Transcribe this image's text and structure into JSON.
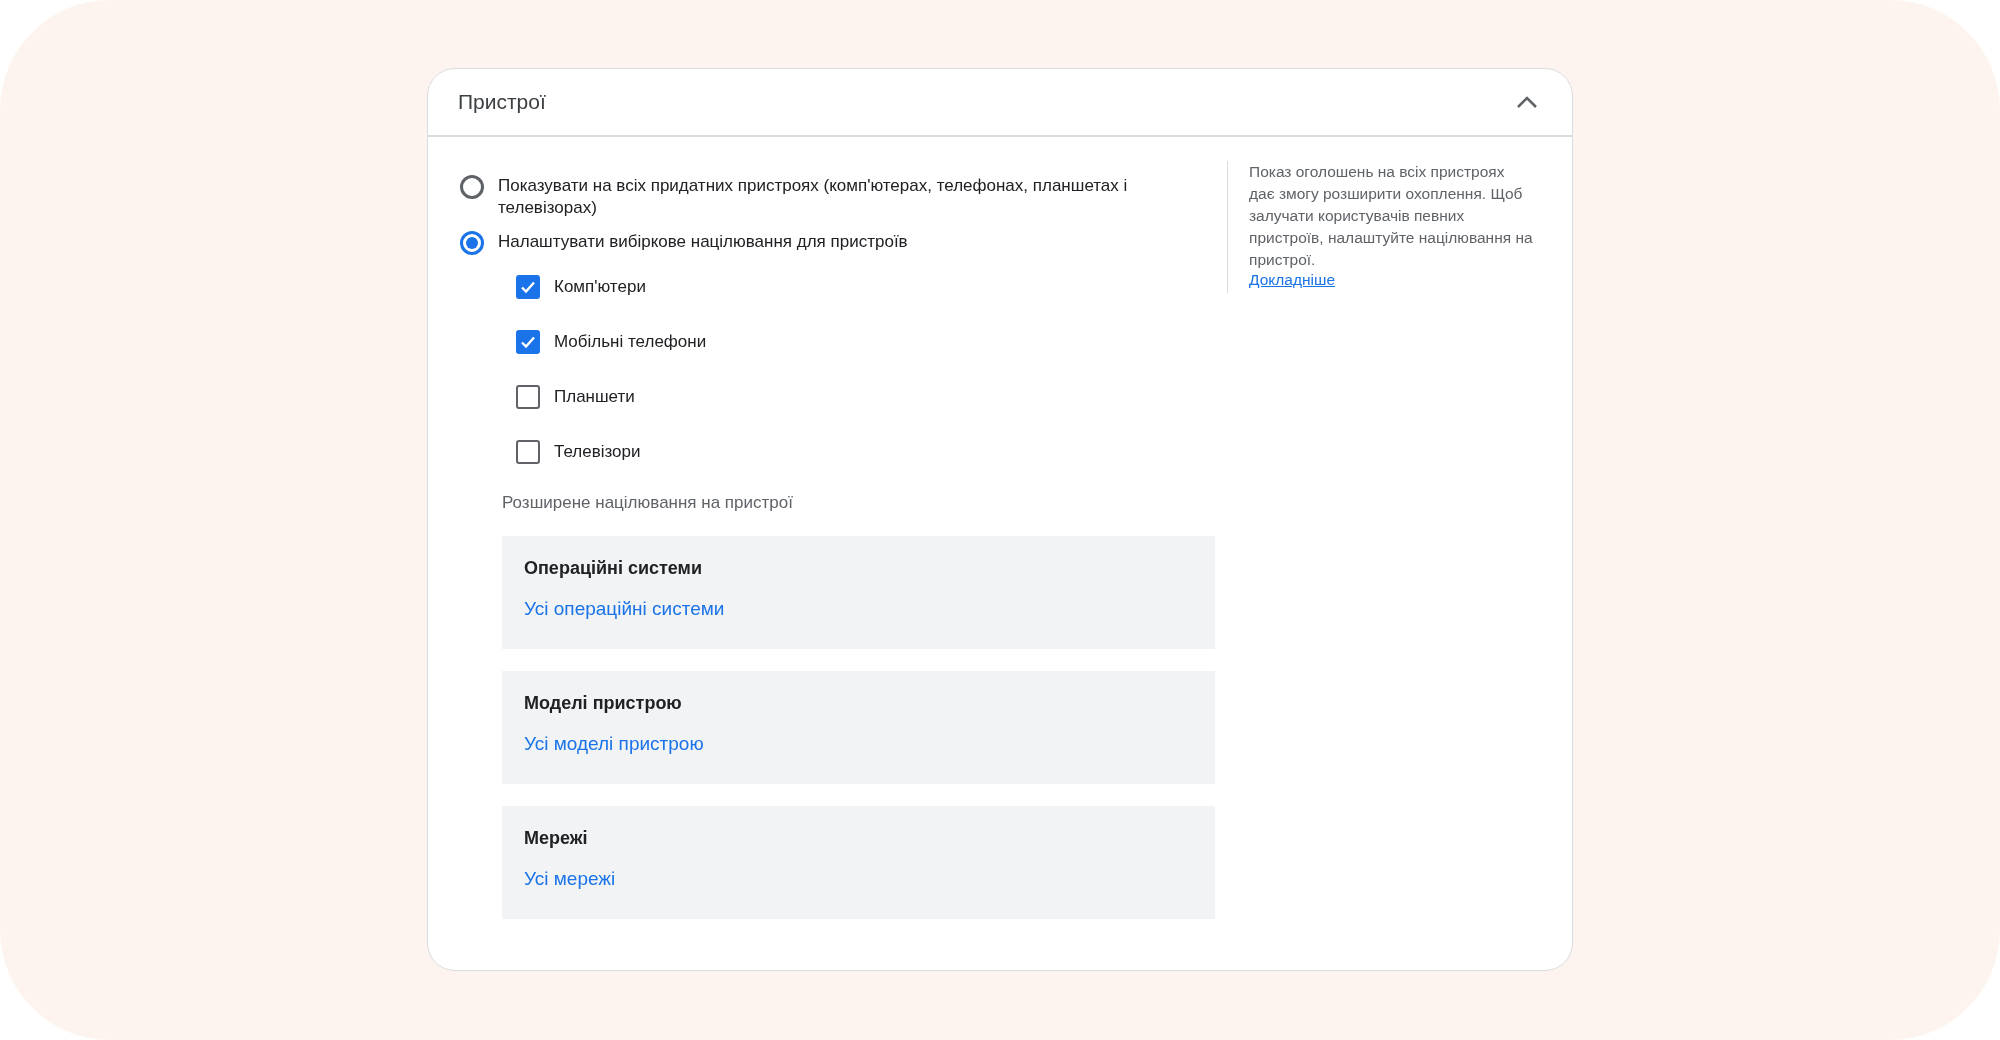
{
  "section": {
    "title": "Пристрої",
    "expanded": true
  },
  "options": [
    {
      "label": "Показувати на всіх придатних пристроях (комп'ютерах, телефонах, планшетах і телевізорах)",
      "selected": false
    },
    {
      "label": "Налаштувати вибіркове націлювання для пристроїв",
      "selected": true
    }
  ],
  "devices": [
    {
      "label": "Комп'ютери",
      "checked": true
    },
    {
      "label": "Мобільні телефони",
      "checked": true
    },
    {
      "label": "Планшети",
      "checked": false
    },
    {
      "label": "Телевізори",
      "checked": false
    }
  ],
  "advanced": {
    "heading": "Розширене націлювання на пристрої",
    "panels": [
      {
        "title": "Операційні системи",
        "link": "Усі операційні системи"
      },
      {
        "title": "Моделі пристрою",
        "link": "Усі моделі пристрою"
      },
      {
        "title": "Мережі",
        "link": "Усі мережі"
      }
    ]
  },
  "help": {
    "text": "Показ оголошень на всіх пристроях дає змогу розширити охоплення. Щоб залучати користувачів певних пристроїв, налаштуйте націлювання на пристрої.",
    "link": "Докладніше"
  }
}
